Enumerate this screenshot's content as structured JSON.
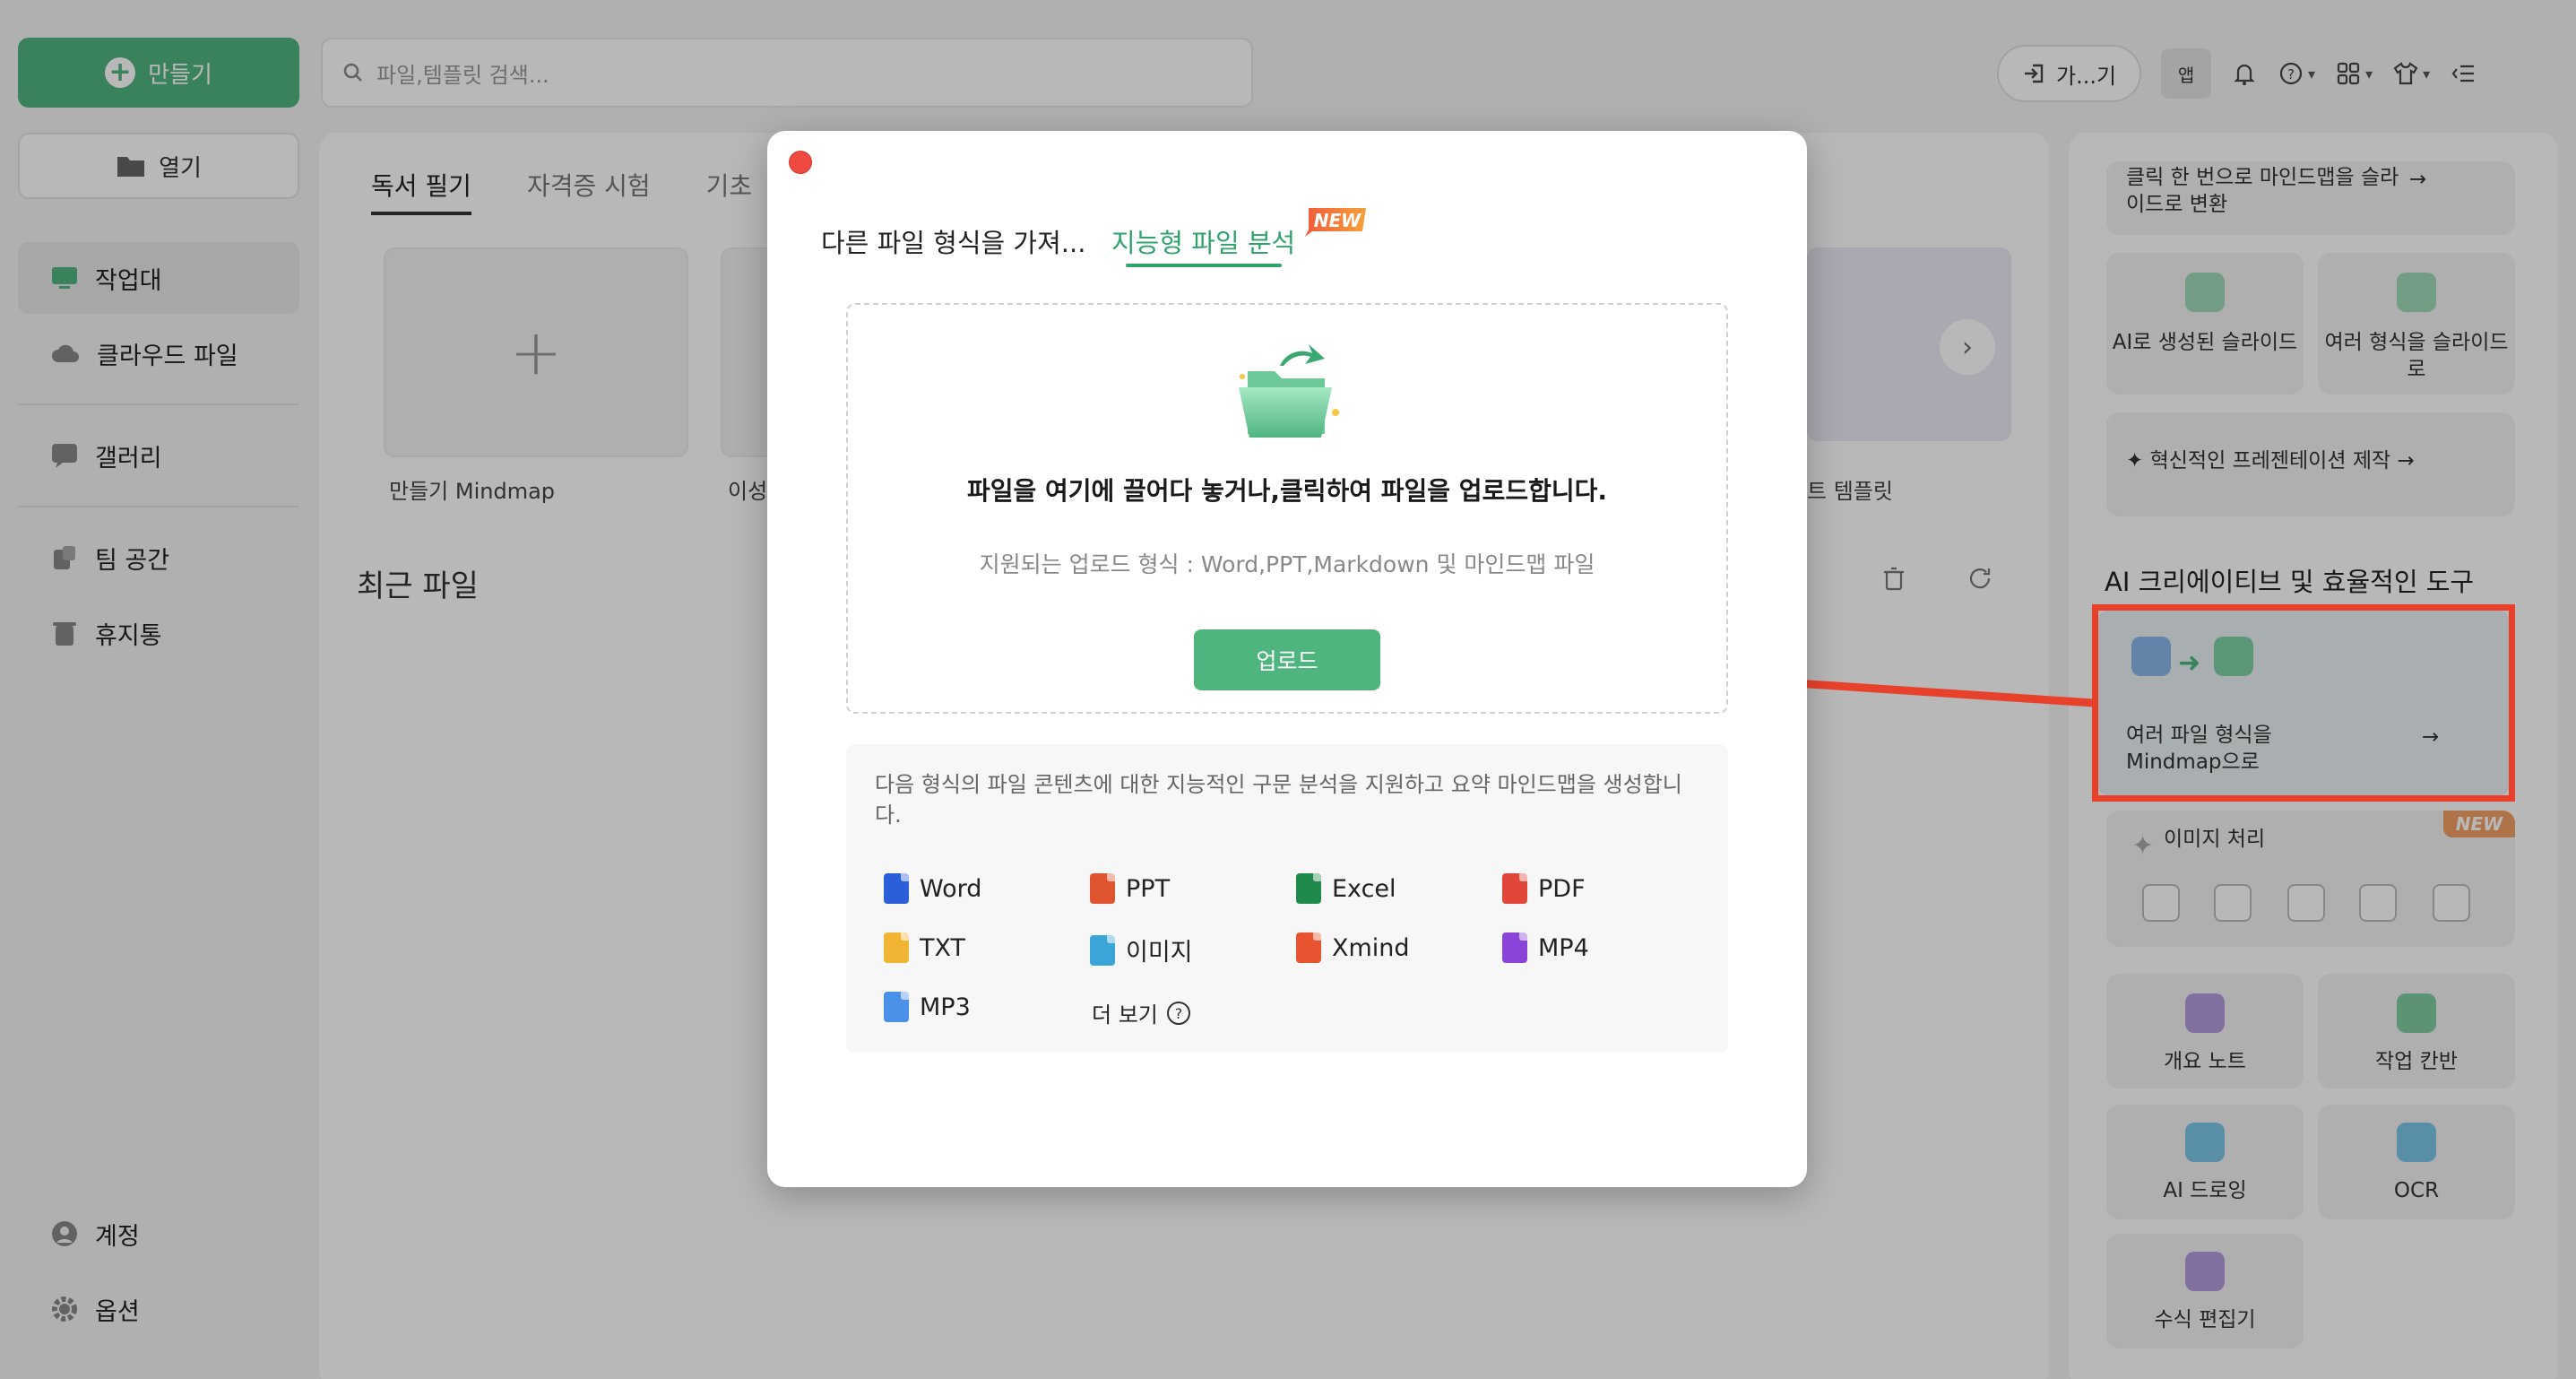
{
  "topbar": {
    "create_label": "만들기",
    "search_placeholder": "파일,템플릿 검색...",
    "join_label": "가...기",
    "app_label": "앱"
  },
  "sidebar": {
    "open_label": "열기",
    "items": [
      {
        "label": "작업대",
        "icon": "workbench-icon"
      },
      {
        "label": "클라우드 파일",
        "icon": "cloud-icon"
      },
      {
        "label": "갤러리",
        "icon": "gallery-icon"
      },
      {
        "label": "팀 공간",
        "icon": "team-icon"
      },
      {
        "label": "휴지통",
        "icon": "trash-icon"
      }
    ],
    "account_label": "계정",
    "options_label": "옵션"
  },
  "main": {
    "tabs": [
      "독서 필기",
      "자격증 시험",
      "기초"
    ],
    "create_card_label": "만들기 Mindmap",
    "card2_label": "이성",
    "card_right_label": "트 템플릿",
    "recent_title": "최근 파일"
  },
  "right_panel": {
    "top_text": "클릭 한 번으로 마인드맵을 슬라이드로 변환",
    "ai_slides": "AI로 생성된 슬라이드",
    "multi_slides": "여러 형식을 슬라이드로",
    "presentation": "혁신적인 프레젠테이션 제작",
    "section_title": "AI 크리에이티브 및 효율적인 도구",
    "multi_to_mindmap": "여러 파일 형식을 Mindmap으로",
    "image_processing": "이미지 처리",
    "new_badge": "NEW",
    "tools": [
      "개요 노트",
      "작업 칸반",
      "AI 드로잉",
      "OCR",
      "수식 편집기"
    ]
  },
  "modal": {
    "tab_import": "다른 파일 형식을 가져...",
    "tab_smart": "지능형 파일 분석",
    "new_badge": "NEW",
    "drop_title": "파일을 여기에 끌어다 놓거나,클릭하여 파일을 업로드합니다.",
    "drop_sub": "지원되는 업로드 형식 : Word,PPT,Markdown 및 마인드맵 파일",
    "upload_label": "업로드",
    "info_text": "다음 형식의 파일 콘텐츠에 대한 지능적인 구문 분석을 지원하고 요약 마인드맵을 생성합니다.",
    "formats": [
      {
        "label": "Word",
        "color": "#2b5fd9"
      },
      {
        "label": "PPT",
        "color": "#e0552f"
      },
      {
        "label": "Excel",
        "color": "#1f8a4c"
      },
      {
        "label": "PDF",
        "color": "#e0463a"
      },
      {
        "label": "TXT",
        "color": "#f2b533"
      },
      {
        "label": "이미지",
        "color": "#3aa6d8"
      },
      {
        "label": "Xmind",
        "color": "#e8542f"
      },
      {
        "label": "MP4",
        "color": "#8a44d8"
      },
      {
        "label": "MP3",
        "color": "#4a8fe8"
      }
    ],
    "more_label": "더 보기"
  },
  "colors": {
    "brand_green": "#4fb57f",
    "accent_green": "#30a46c",
    "annotation_red": "#e8412b"
  }
}
